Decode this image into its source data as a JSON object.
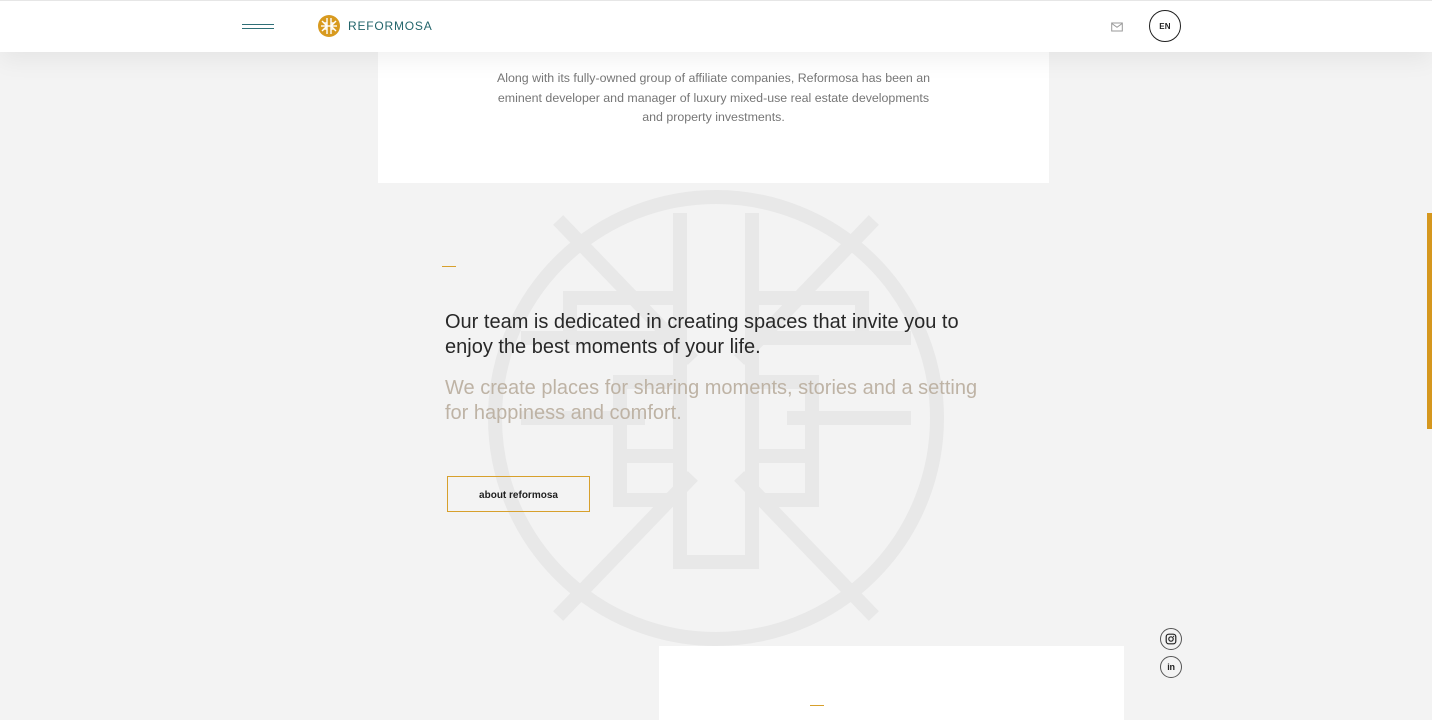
{
  "header": {
    "brand_name": "REFORMOSA",
    "language": "EN"
  },
  "intro": {
    "text": "Along with its fully-owned group of affiliate companies, Reformosa has been an eminent developer and manager of luxury mixed-use real estate developments and property investments."
  },
  "main": {
    "headline": "Our team is dedicated in creating spaces that invite you to enjoy the best moments of your life.",
    "subheadline": "We create places for sharing moments, stories and a setting for happiness and comfort.",
    "button_label": "about reformosa"
  },
  "social": {
    "linkedin_label": "in"
  },
  "colors": {
    "background": "#f3f3f3",
    "card": "#ffffff",
    "accent_gold": "#d7a02c",
    "brand_teal": "#23656b",
    "headline": "#282828",
    "subheadline": "#beb3a5",
    "body_text": "#767676"
  },
  "icons": {
    "menu": "hamburger-icon",
    "logo": "reformosa-logo-icon",
    "mail": "mail-icon",
    "instagram": "instagram-icon",
    "linkedin": "linkedin-icon",
    "watermark": "reformosa-watermark-icon"
  }
}
